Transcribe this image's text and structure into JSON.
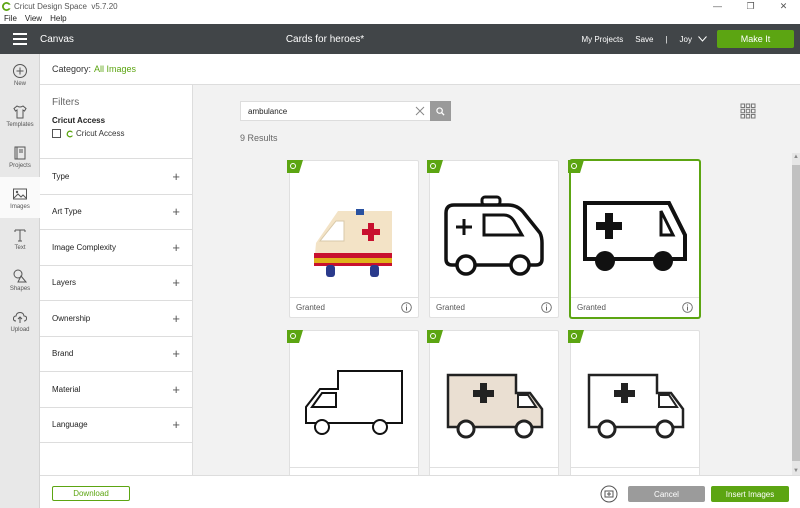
{
  "titlebar": {
    "app_name": "Cricut Design Space",
    "version": "v5.7.20",
    "controls": [
      "—",
      "❐",
      "✕"
    ]
  },
  "menu": {
    "items": [
      "File",
      "View",
      "Help"
    ]
  },
  "header": {
    "canvas_label": "Canvas",
    "project_title": "Cards for heroes*",
    "my_projects": "My Projects",
    "save": "Save",
    "divider": "|",
    "user": "Joy",
    "make_it": "Make It"
  },
  "tools": [
    {
      "label": "New",
      "icon": "plus-circle-icon"
    },
    {
      "label": "Templates",
      "icon": "shirt-icon"
    },
    {
      "label": "Projects",
      "icon": "book-icon"
    },
    {
      "label": "Images",
      "icon": "image-icon"
    },
    {
      "label": "Text",
      "icon": "text-t-icon"
    },
    {
      "label": "Shapes",
      "icon": "shapes-icon"
    },
    {
      "label": "Upload",
      "icon": "cloud-upload-icon"
    }
  ],
  "category": {
    "label": "Category:",
    "value": "All Images"
  },
  "filters": {
    "title": "Filters",
    "access_title": "Cricut Access",
    "access_option": "Cricut Access",
    "rows": [
      "Type",
      "Art Type",
      "Image Complexity",
      "Layers",
      "Ownership",
      "Brand",
      "Material",
      "Language"
    ],
    "expand_symbol": "+"
  },
  "search": {
    "value": "ambulance",
    "results_text": "9 Results"
  },
  "cards": [
    {
      "image": "ambulance-colored",
      "status": "Granted",
      "selected": false
    },
    {
      "image": "ambulance-outline-van",
      "status": "Granted",
      "selected": false
    },
    {
      "image": "ambulance-bold-truck",
      "status": "Granted",
      "selected": true
    },
    {
      "image": "ambulance-line-truck",
      "status": "",
      "selected": false
    },
    {
      "image": "ambulance-beige-truck",
      "status": "",
      "selected": false
    },
    {
      "image": "ambulance-white-truck",
      "status": "",
      "selected": false
    }
  ],
  "footer": {
    "download": "Download",
    "cancel": "Cancel",
    "insert": "Insert Images"
  },
  "colors": {
    "accent_green": "#5ca512",
    "header_bg": "#414548",
    "cancel_gray": "#9b9b9b"
  }
}
